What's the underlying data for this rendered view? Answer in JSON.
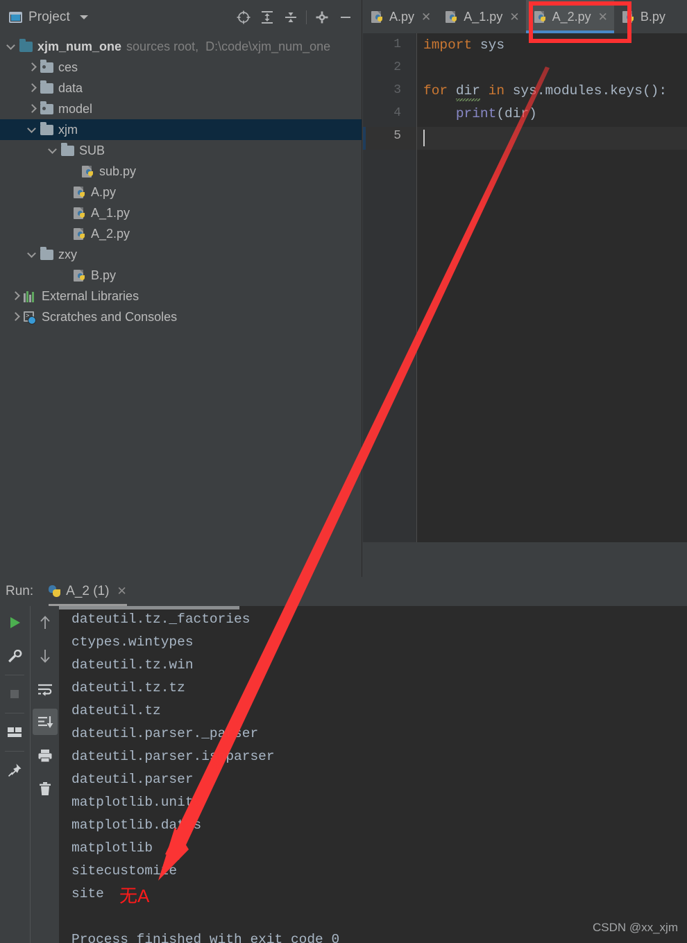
{
  "project_panel": {
    "title": "Project",
    "window_icon": "project-window-icon",
    "toolbar_icons": [
      "locate-target-icon",
      "expand-all-icon",
      "collapse-all-icon",
      "settings-gear-icon",
      "hide-panel-icon"
    ],
    "tree": [
      {
        "label": "xjm_num_one",
        "meta": "sources root,",
        "path": "D:\\code\\xjm_num_one",
        "indent": 0,
        "arrow": "down",
        "icon": "folder-teal",
        "bold": true,
        "selected": false
      },
      {
        "label": "ces",
        "indent": 1,
        "arrow": "right",
        "icon": "folder-source",
        "selected": false
      },
      {
        "label": "data",
        "indent": 1,
        "arrow": "right",
        "icon": "folder",
        "selected": false
      },
      {
        "label": "model",
        "indent": 1,
        "arrow": "right",
        "icon": "folder-source",
        "selected": false
      },
      {
        "label": "xjm",
        "indent": 1,
        "arrow": "down",
        "icon": "folder",
        "selected": true
      },
      {
        "label": "SUB",
        "indent": 2,
        "arrow": "down",
        "icon": "folder",
        "selected": false
      },
      {
        "label": "sub.py",
        "indent": 3,
        "arrow": "none",
        "icon": "python-file",
        "selected": false
      },
      {
        "label": "A.py",
        "indent": 2.6,
        "arrow": "none",
        "icon": "python-file",
        "selected": false
      },
      {
        "label": "A_1.py",
        "indent": 2.6,
        "arrow": "none",
        "icon": "python-file",
        "selected": false
      },
      {
        "label": "A_2.py",
        "indent": 2.6,
        "arrow": "none",
        "icon": "python-file",
        "selected": false
      },
      {
        "label": "zxy",
        "indent": 1,
        "arrow": "down",
        "icon": "folder",
        "selected": false
      },
      {
        "label": "B.py",
        "indent": 2.6,
        "arrow": "none",
        "icon": "python-file",
        "selected": false
      },
      {
        "label": "External Libraries",
        "indent": 0.2,
        "arrow": "right",
        "icon": "libraries",
        "selected": false
      },
      {
        "label": "Scratches and Consoles",
        "indent": 0.2,
        "arrow": "right",
        "icon": "scratches",
        "selected": false
      }
    ]
  },
  "editor": {
    "tabs": [
      {
        "label": "A.py",
        "active": false,
        "closable": true
      },
      {
        "label": "A_1.py",
        "active": false,
        "closable": true
      },
      {
        "label": "A_2.py",
        "active": true,
        "closable": true
      },
      {
        "label": "B.py",
        "active": false,
        "closable": false
      }
    ],
    "line_numbers": [
      "1",
      "2",
      "3",
      "4",
      "5"
    ],
    "current_line": 5,
    "code_lines": [
      {
        "n": 1,
        "tokens": [
          {
            "t": "import",
            "c": "kw"
          },
          {
            "t": " sys",
            "c": "pl"
          }
        ]
      },
      {
        "n": 2,
        "tokens": []
      },
      {
        "n": 3,
        "tokens": [
          {
            "t": "for",
            "c": "kw"
          },
          {
            "t": " ",
            "c": "pl"
          },
          {
            "t": "dir",
            "c": "underlined"
          },
          {
            "t": " ",
            "c": "pl"
          },
          {
            "t": "in",
            "c": "kw"
          },
          {
            "t": " sys.modules.keys():",
            "c": "pl"
          }
        ]
      },
      {
        "n": 4,
        "tokens": [
          {
            "t": "    ",
            "c": "pl"
          },
          {
            "t": "print",
            "c": "fn"
          },
          {
            "t": "(dir)",
            "c": "pl"
          }
        ]
      },
      {
        "n": 5,
        "tokens": []
      }
    ]
  },
  "run_panel": {
    "run_label": "Run:",
    "tab_name": "A_2 (1)",
    "toolbar_left": [
      "run-icon",
      "wrench-icon",
      "stop-icon",
      "layout-icon",
      "pin-icon"
    ],
    "toolbar_right": [
      "arrow-up-icon",
      "arrow-down-icon",
      "soft-wrap-icon",
      "scroll-to-end-icon",
      "print-icon",
      "trash-icon"
    ],
    "selected_right_tool": "scroll-to-end-icon",
    "console_lines": [
      "dateutil.tz._factories",
      "ctypes.wintypes",
      "dateutil.tz.win",
      "dateutil.tz.tz",
      "dateutil.tz",
      "dateutil.parser._parser",
      "dateutil.parser.isoparser",
      "dateutil.parser",
      "matplotlib.units",
      "matplotlib.dates",
      "matplotlib",
      "sitecustomize",
      "site"
    ],
    "exit_message": "Process finished with exit code 0"
  },
  "annotations": {
    "red_note": "无A",
    "highlight_color": "#fc3131",
    "arrow_color": "#fb3434"
  },
  "watermark": "CSDN @xx_xjm"
}
